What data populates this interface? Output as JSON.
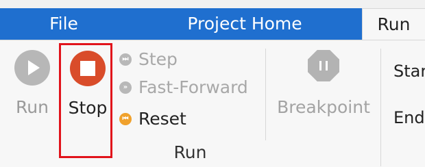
{
  "tabs": {
    "file": "File",
    "project_home": "Project Home",
    "run": "Run"
  },
  "ribbon": {
    "run_button_label": "Run",
    "stop_button_label": "Stop",
    "step_label": "Step",
    "fast_forward_label": "Fast-Forward",
    "reset_label": "Reset",
    "breakpoint_label": "Breakpoint",
    "group_label": "Run",
    "right_partial_1": "Star",
    "right_partial_2": "End"
  },
  "icons": {
    "run": "play-icon",
    "stop": "stop-icon",
    "step": "step-icon",
    "fast_forward": "fast-forward-icon",
    "reset": "reset-icon",
    "breakpoint": "breakpoint-icon"
  },
  "colors": {
    "tab_blue": "#1f6fcf",
    "stop_red": "#d94c2a",
    "highlight_red": "#e1131b",
    "reset_orange": "#f0a12c",
    "disabled_gray": "#b8b8b8"
  }
}
